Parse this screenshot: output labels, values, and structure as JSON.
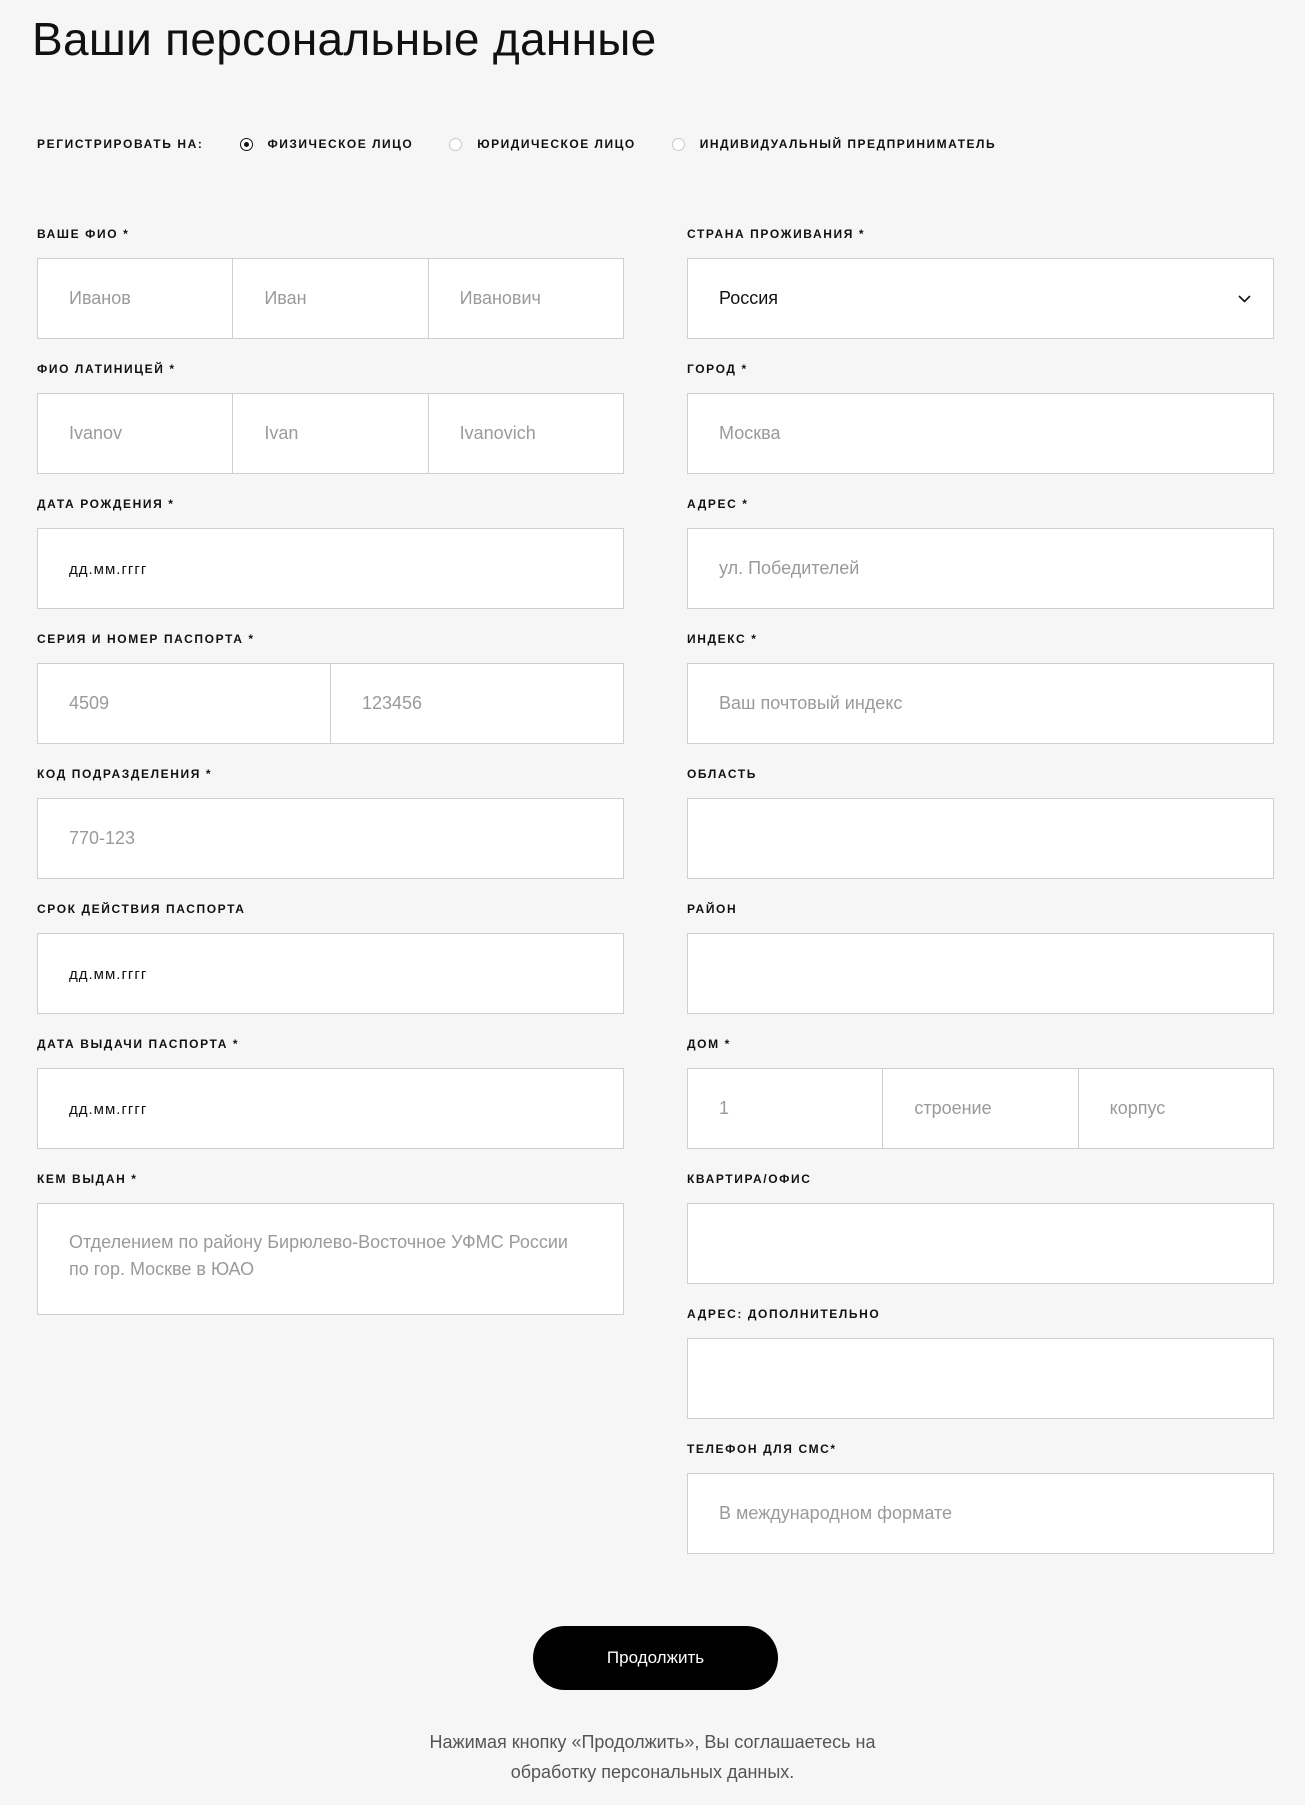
{
  "page": {
    "title": "Ваши персональные данные"
  },
  "registration": {
    "label": "РЕГИСТРИРОВАТЬ НА:",
    "options": [
      {
        "label": "ФИЗИЧЕСКОЕ ЛИЦО",
        "selected": true
      },
      {
        "label": "ЮРИДИЧЕСКОЕ ЛИЦО",
        "selected": false
      },
      {
        "label": "ИНДИВИДУАЛЬНЫЙ ПРЕДПРИНИМАТЕЛЬ",
        "selected": false
      }
    ]
  },
  "left": {
    "fio": {
      "label": "ВАШЕ ФИО *",
      "placeholders": [
        "Иванов",
        "Иван",
        "Иванович"
      ]
    },
    "fio_latin": {
      "label": "ФИО ЛАТИНИЦЕЙ *",
      "placeholders": [
        "Ivanov",
        "Ivan",
        "Ivanovich"
      ]
    },
    "birth_date": {
      "label": "ДАТА РОЖДЕНИЯ *",
      "placeholder": "дд.мм.гггг"
    },
    "passport": {
      "label": "СЕРИЯ И НОМЕР ПАСПОРТА *",
      "placeholders": [
        "4509",
        "123456"
      ]
    },
    "division_code": {
      "label": "КОД ПОДРАЗДЕЛЕНИЯ *",
      "placeholder": "770-123"
    },
    "passport_expiry": {
      "label": "СРОК ДЕЙСТВИЯ ПАСПОРТА",
      "placeholder": "дд.мм.гггг"
    },
    "passport_issue_date": {
      "label": "ДАТА ВЫДАЧИ ПАСПОРТА *",
      "placeholder": "дд.мм.гггг"
    },
    "issued_by": {
      "label": "КЕМ ВЫДАН *",
      "placeholder": "Отделением по району Бирюлево-Восточное УФМС России по гор. Москве в ЮАО"
    }
  },
  "right": {
    "country": {
      "label": "СТРАНА ПРОЖИВАНИЯ *",
      "value": "Россия"
    },
    "city": {
      "label": "ГОРОД *",
      "placeholder": "Москва"
    },
    "address": {
      "label": "АДРЕС *",
      "placeholder": "ул. Победителей"
    },
    "postal_index": {
      "label": "ИНДЕКС *",
      "placeholder": "Ваш почтовый индекс"
    },
    "region": {
      "label": "ОБЛАСТЬ",
      "placeholder": ""
    },
    "district": {
      "label": "РАЙОН",
      "placeholder": ""
    },
    "house": {
      "label": "ДОМ *",
      "placeholders": [
        "1",
        "строение",
        "корпус"
      ]
    },
    "apartment": {
      "label": "КВАРТИРА/ОФИС",
      "placeholder": ""
    },
    "address_extra": {
      "label": "АДРЕС: ДОПОЛНИТЕЛЬНО",
      "placeholder": ""
    },
    "phone": {
      "label": "ТЕЛЕФОН ДЛЯ СМС*",
      "placeholder": "В международном формате"
    }
  },
  "submit": {
    "label": "Продолжить"
  },
  "consent": {
    "line1": "Нажимая кнопку «Продолжить», Вы соглашаетесь на",
    "line2": "обработку персональных данных."
  },
  "icons": {
    "select_arrow": "chevron-down-icon"
  }
}
